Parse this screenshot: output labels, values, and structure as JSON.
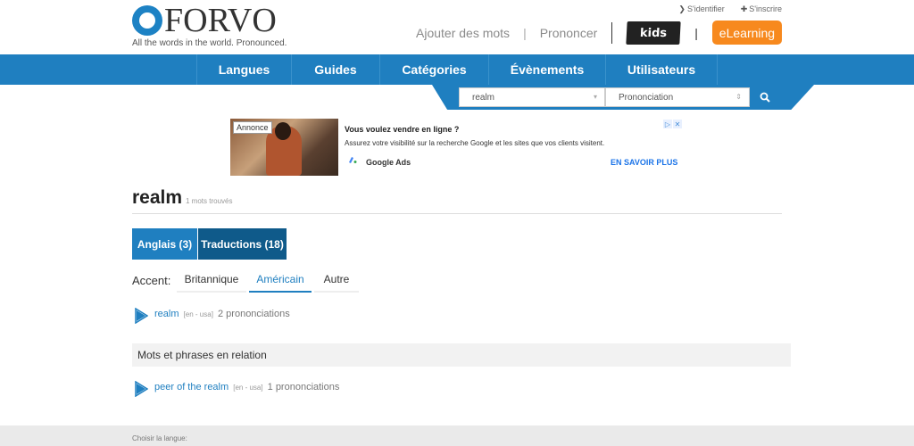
{
  "header": {
    "logo_text": "FORVO",
    "tagline": "All the words in the world. Pronounced.",
    "sign_in": "S'identifier",
    "sign_up": "S'inscrire",
    "add_words": "Ajouter des mots",
    "pronounce": "Prononcer",
    "kids": "kids",
    "elearning": "eLearning",
    "pipe": "|"
  },
  "menu": {
    "items": [
      {
        "label": "Langues"
      },
      {
        "label": "Guides"
      },
      {
        "label": "Catégories"
      },
      {
        "label": "Évènements"
      },
      {
        "label": "Utilisateurs"
      }
    ]
  },
  "search": {
    "query": "realm",
    "mode": "Prononciation"
  },
  "ad": {
    "badge": "Annonce",
    "title": "Vous voulez vendre en ligne ?",
    "description": "Assurez votre visibilité sur la recherche Google et les sites que vos clients visitent.",
    "brand": "Google Ads",
    "cta": "EN SAVOIR PLUS",
    "gicon_text": "Google Ads"
  },
  "word": {
    "title": "realm",
    "count": "1 mots trouvés"
  },
  "tabs": [
    {
      "label": "Anglais (3)"
    },
    {
      "label": "Traductions (18)"
    }
  ],
  "accent": {
    "label": "Accent:",
    "options": [
      {
        "label": "Britannique"
      },
      {
        "label": "Américain"
      },
      {
        "label": "Autre"
      }
    ]
  },
  "results": [
    {
      "word": "realm",
      "lang": "[en - usa]",
      "count": "2 prononciations"
    }
  ],
  "related": {
    "heading": "Mots et phrases en relation",
    "items": [
      {
        "word": "peer of the realm",
        "lang": "[en - usa]",
        "count": "1 prononciations"
      }
    ]
  },
  "footer": {
    "choose_language": "Choisir la langue:"
  },
  "colors": {
    "brand_blue": "#1f7fc0",
    "active_tab": "#0f5a8a",
    "elearning_orange": "#f7891e"
  }
}
